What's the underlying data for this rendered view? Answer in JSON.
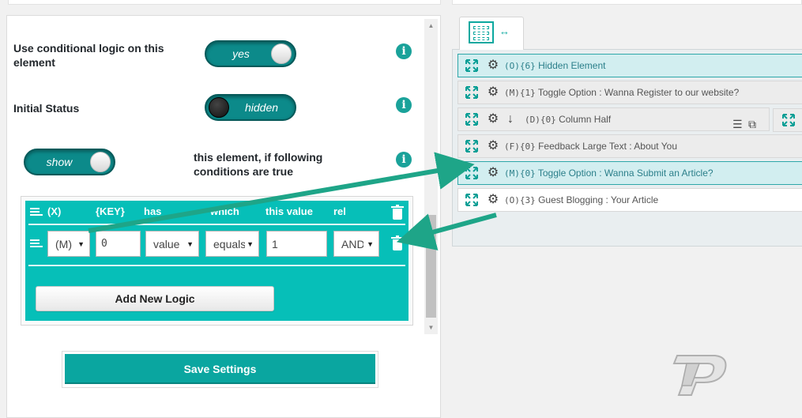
{
  "settings": {
    "conditional_label": "Use conditional logic on this element",
    "conditional_toggle": "yes",
    "initial_status_label": "Initial Status",
    "initial_status_toggle": "hidden",
    "action_toggle": "show",
    "action_text": "this element, if following conditions are true",
    "info_glyph": "i"
  },
  "logic": {
    "headers": [
      "(X)",
      "{KEY}",
      "has",
      "which",
      "this value",
      "rel"
    ],
    "row": {
      "x_select": "(M)",
      "key_input": "0",
      "has_select": "value",
      "which_select": "equals",
      "value_input": "1",
      "rel_select": "AND"
    },
    "add_button": "Add New Logic"
  },
  "save_button": "Save Settings",
  "builder": {
    "rows": [
      {
        "code": "(O){6}",
        "name": "Hidden Element",
        "highlight": true
      },
      {
        "code": "(M){1}",
        "name": "Toggle Option : Wanna Register to our website?",
        "highlight": false
      },
      {
        "code": "(D){0}",
        "name": "Column Half",
        "highlight": false
      },
      {
        "code": "(F){0}",
        "name": "Feedback Large Text : About You",
        "highlight": false
      },
      {
        "code": "(M){0}",
        "name": "Toggle Option : Wanna Submit an Article?",
        "highlight": true
      },
      {
        "code": "(O){3}",
        "name": "Guest Blogging : Your Article",
        "highlight": false
      }
    ]
  },
  "colors": {
    "teal": "#06bfb8",
    "teal_dark": "#0c8a8a",
    "arrow": "#1ea588"
  }
}
